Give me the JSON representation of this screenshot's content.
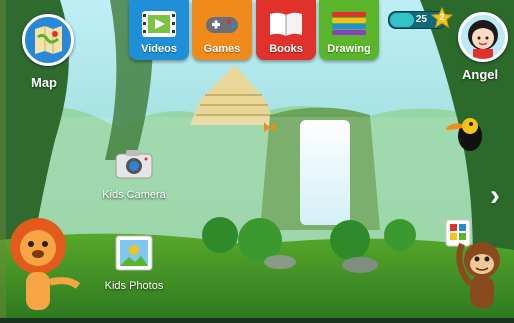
{
  "nav": {
    "tabs": [
      {
        "label": "Videos",
        "icon": "film-icon",
        "color": "#1f8fd8"
      },
      {
        "label": "Games",
        "icon": "gamepad-icon",
        "color": "#f08a1a"
      },
      {
        "label": "Books",
        "icon": "book-icon",
        "color": "#e0312b"
      },
      {
        "label": "Drawing",
        "icon": "crayons-icon",
        "color": "#5bb52a"
      }
    ]
  },
  "map": {
    "label": "Map",
    "icon": "map-icon"
  },
  "profile": {
    "name": "Angel",
    "icon": "girl-avatar-icon"
  },
  "score": {
    "coins": "25",
    "level": "2",
    "icon": "star-icon",
    "fill_fraction": 0.45
  },
  "apps": [
    {
      "name": "Kids Camera",
      "icon": "camera-icon"
    },
    {
      "name": "Kids Photos",
      "icon": "photo-icon"
    }
  ],
  "next": {
    "icon": "chevron-right-icon"
  },
  "colors": {
    "sky": "#9fe0f0",
    "jungle": "#2f7a2a",
    "ground": "#6fbf2a"
  }
}
